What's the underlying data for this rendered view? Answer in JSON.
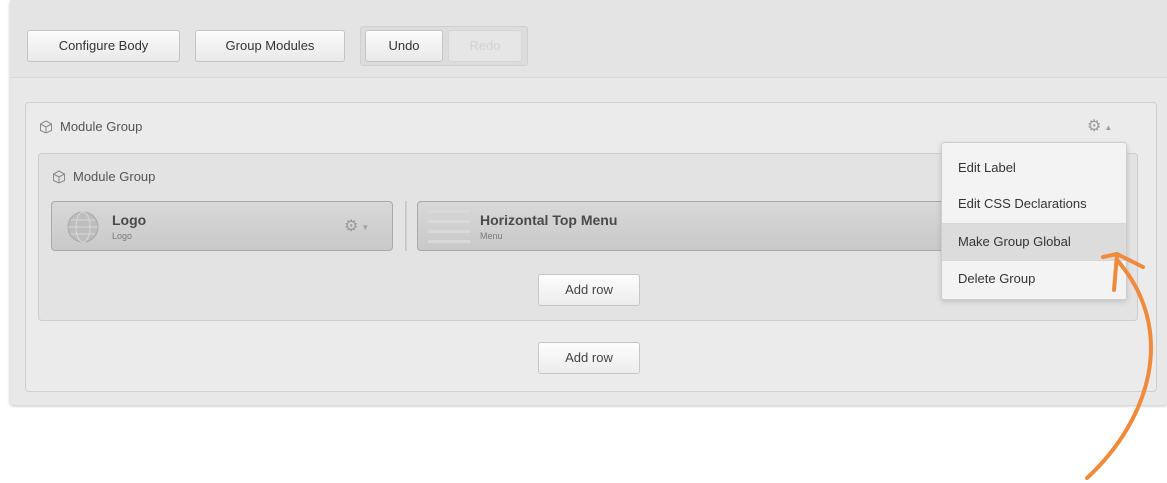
{
  "toolbar": {
    "configure_body": "Configure Body",
    "group_modules": "Group Modules",
    "undo": "Undo",
    "redo": "Redo"
  },
  "outer_group": {
    "label": "Module Group",
    "icon": "cube-icon",
    "add_row": "Add row"
  },
  "inner_group": {
    "label": "Module Group",
    "icon": "cube-icon",
    "add_row": "Add row"
  },
  "modules": [
    {
      "title": "Logo",
      "subtitle": "Logo",
      "icon": "globe-icon"
    },
    {
      "title": "Horizontal Top Menu",
      "subtitle": "Menu",
      "icon": "menu-lines-icon"
    }
  ],
  "dropdown": {
    "items": [
      "Edit Label",
      "Edit CSS Declarations",
      "Make Group Global",
      "Delete Group"
    ],
    "highlighted_item": "Make Group Global"
  },
  "colors": {
    "accent_arrow": "#f08a3c",
    "panel_bg": "#e8e8e8",
    "module_bg": "#cfcfcf"
  }
}
